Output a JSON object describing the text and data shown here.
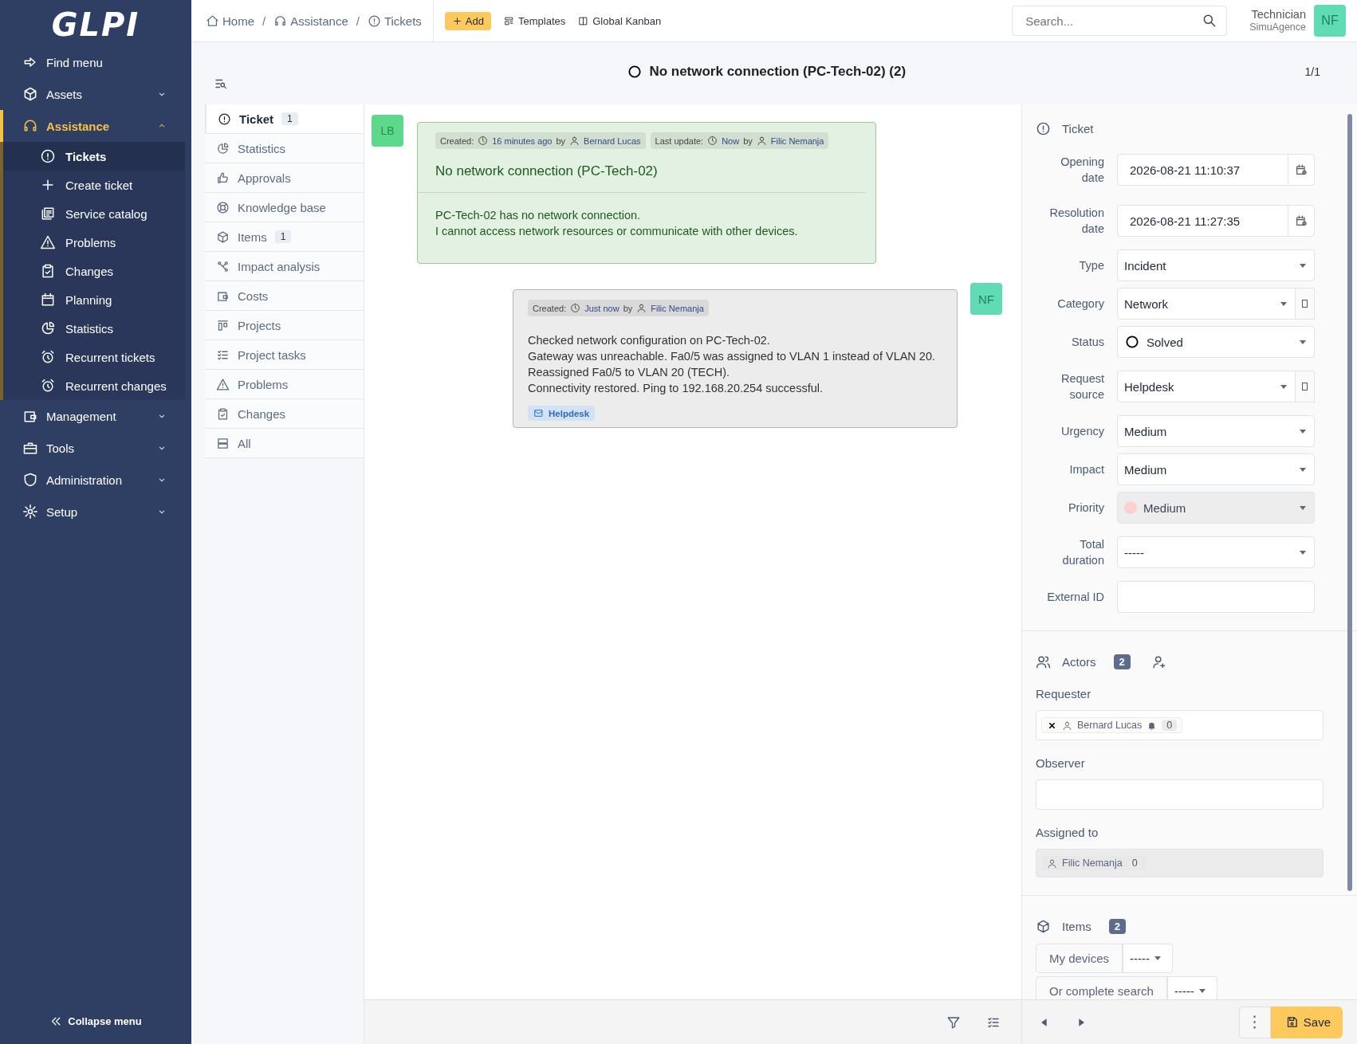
{
  "sidebar": {
    "logo": "GLPI",
    "items": [
      {
        "kind": "link",
        "label": "Find menu"
      },
      {
        "kind": "section",
        "label": "Assets",
        "expanded": false,
        "selected": false
      },
      {
        "kind": "section",
        "label": "Assistance",
        "expanded": true,
        "selected": true,
        "children": [
          {
            "label": "Tickets",
            "selected": true
          },
          {
            "label": "Create ticket",
            "selected": false
          },
          {
            "label": "Service catalog",
            "selected": false
          },
          {
            "label": "Problems",
            "selected": false
          },
          {
            "label": "Changes",
            "selected": false
          },
          {
            "label": "Planning",
            "selected": false
          },
          {
            "label": "Statistics",
            "selected": false
          },
          {
            "label": "Recurrent tickets",
            "selected": false
          },
          {
            "label": "Recurrent changes",
            "selected": false
          }
        ]
      },
      {
        "kind": "section",
        "label": "Management",
        "expanded": false,
        "selected": false
      },
      {
        "kind": "section",
        "label": "Tools",
        "expanded": false,
        "selected": false
      },
      {
        "kind": "section",
        "label": "Administration",
        "expanded": false,
        "selected": false
      },
      {
        "kind": "section",
        "label": "Setup",
        "expanded": false,
        "selected": false
      }
    ],
    "collapse": "Collapse menu"
  },
  "header": {
    "breadcrumbs": [
      {
        "label": "Home"
      },
      {
        "separator": "/",
        "label": "Assistance"
      },
      {
        "separator": "/",
        "label": "Tickets"
      }
    ],
    "add_button": "Add",
    "links": [
      "Templates",
      "Global Kanban"
    ],
    "search": {
      "placeholder": "Search..."
    },
    "user": {
      "name": "Technician",
      "entity": "SimuAgence",
      "initials": "NF"
    }
  },
  "title_bar": {
    "title": "No network connection (PC-Tech-02) (2)",
    "pager": "1/1"
  },
  "tabs": [
    {
      "label": "Ticket",
      "count": "1",
      "selected": true
    },
    {
      "label": "Statistics",
      "selected": false
    },
    {
      "label": "Approvals",
      "selected": false
    },
    {
      "label": "Knowledge base",
      "selected": false
    },
    {
      "label": "Items",
      "count": "1",
      "selected": false
    },
    {
      "label": "Impact analysis",
      "selected": false
    },
    {
      "label": "Costs",
      "selected": false
    },
    {
      "label": "Projects",
      "selected": false
    },
    {
      "label": "Project tasks",
      "selected": false
    },
    {
      "label": "Problems",
      "selected": false
    },
    {
      "label": "Changes",
      "selected": false
    },
    {
      "label": "All",
      "selected": false
    }
  ],
  "timeline": [
    {
      "kind": "description",
      "initials": "LB",
      "meta": [
        {
          "label": "Created:",
          "time": "16 minutes ago",
          "by": "by",
          "author": "Bernard Lucas"
        },
        {
          "label": "Last update:",
          "time": "Now",
          "by": "by",
          "author": "Filic Nemanja"
        }
      ],
      "title": "No network connection (PC-Tech-02)",
      "lines": [
        "PC-Tech-02 has no network connection.",
        "I cannot access network resources or communicate with other devices."
      ]
    },
    {
      "kind": "followup",
      "initials": "NF",
      "meta": [
        {
          "label": "Created:",
          "time": "Just now",
          "by": "by",
          "author": "Filic Nemanja"
        }
      ],
      "lines": [
        "Checked network configuration on PC-Tech-02.",
        "Gateway was unreachable. Fa0/5 was assigned to VLAN 1 instead of VLAN 20.",
        "Reassigned Fa0/5 to VLAN 20 (TECH).",
        "Connectivity restored. Ping to 192.168.20.254 successful."
      ],
      "source": "Helpdesk"
    }
  ],
  "ticket_panel": {
    "heading": "Ticket",
    "fields": [
      {
        "label": "Opening date",
        "kind": "date",
        "value": "2026-08-21 11:10:37",
        "disabled": false
      },
      {
        "label": "Resolution date",
        "kind": "date",
        "value": "2026-08-21 11:27:35",
        "disabled": false
      },
      {
        "label": "Type",
        "kind": "select",
        "value": "Incident",
        "disabled": false
      },
      {
        "label": "Category",
        "kind": "select-plus",
        "value": "Network",
        "disabled": false
      },
      {
        "label": "Status",
        "kind": "status",
        "value": "Solved",
        "disabled": false
      },
      {
        "label": "Request source",
        "kind": "select-plus",
        "value": "Helpdesk",
        "disabled": false
      },
      {
        "label": "Urgency",
        "kind": "select",
        "value": "Medium",
        "disabled": false
      },
      {
        "label": "Impact",
        "kind": "select",
        "value": "Medium",
        "disabled": false
      },
      {
        "label": "Priority",
        "kind": "priority",
        "value": "Medium",
        "color": "#fdd1d1",
        "disabled": true
      },
      {
        "label": "Total duration",
        "kind": "select",
        "value": "-----",
        "disabled": false
      },
      {
        "label": "External ID",
        "kind": "input",
        "disabled": false
      }
    ]
  },
  "actors": {
    "heading": "Actors",
    "count": "2",
    "groups": [
      {
        "label": "Requester",
        "disabled": false,
        "people": [
          {
            "name": "Bernard Lucas",
            "count": "0",
            "removable": true,
            "notify": true
          }
        ]
      },
      {
        "label": "Observer",
        "disabled": false
      },
      {
        "label": "Assigned to",
        "disabled": true,
        "people": [
          {
            "name": "Filic Nemanja",
            "count": "0",
            "removable": false,
            "notify": false
          }
        ]
      }
    ]
  },
  "items": {
    "heading": "Items",
    "count": "2",
    "selectors": [
      {
        "label": "My devices",
        "value": "-----"
      },
      {
        "label": "Or complete search",
        "value": "-----"
      }
    ]
  },
  "footer": {
    "save": "Save"
  }
}
